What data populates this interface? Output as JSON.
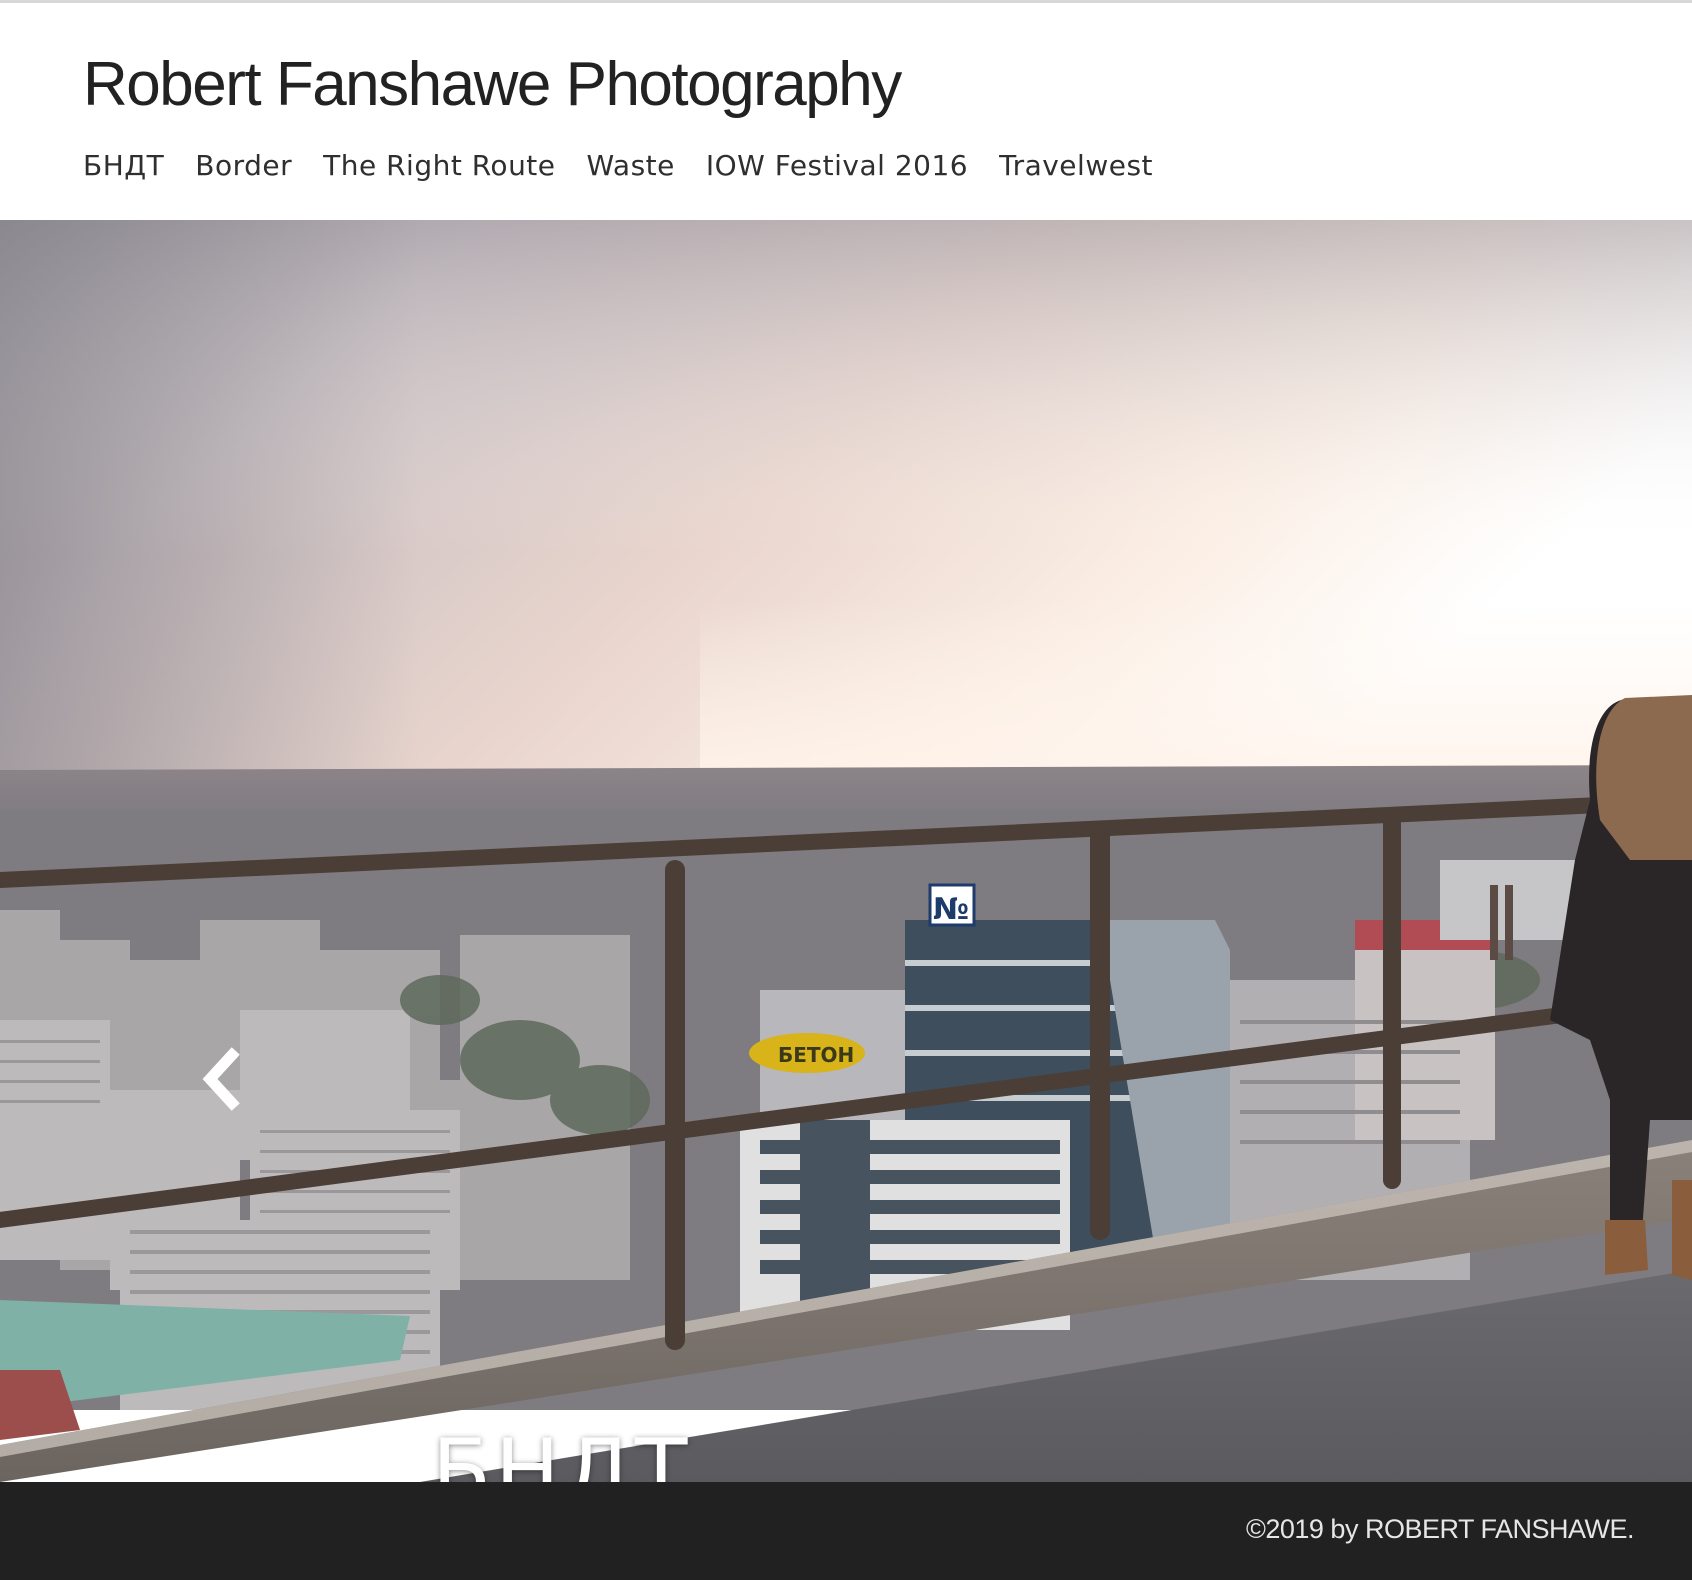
{
  "site": {
    "title": "Robert Fanshawe Photography"
  },
  "nav": {
    "items": [
      {
        "label": "БНДТ"
      },
      {
        "label": "Border"
      },
      {
        "label": "The Right Route"
      },
      {
        "label": "Waste"
      },
      {
        "label": "IOW Festival 2016"
      },
      {
        "label": "Travelwest"
      }
    ]
  },
  "slideshow": {
    "current_title": "БНДТ",
    "prev_icon": "chevron-left-icon",
    "photo_signage": [
      "№",
      "БЕТОН"
    ]
  },
  "footer": {
    "copyright": "©2019 by ROBERT FANSHAWE."
  },
  "colors": {
    "header_bg": "#ffffff",
    "title_text": "#222222",
    "nav_text": "#2f2f2f",
    "footer_bg": "#212121",
    "footer_text": "#e6e6e6",
    "slide_title_text": "#ffffff"
  }
}
